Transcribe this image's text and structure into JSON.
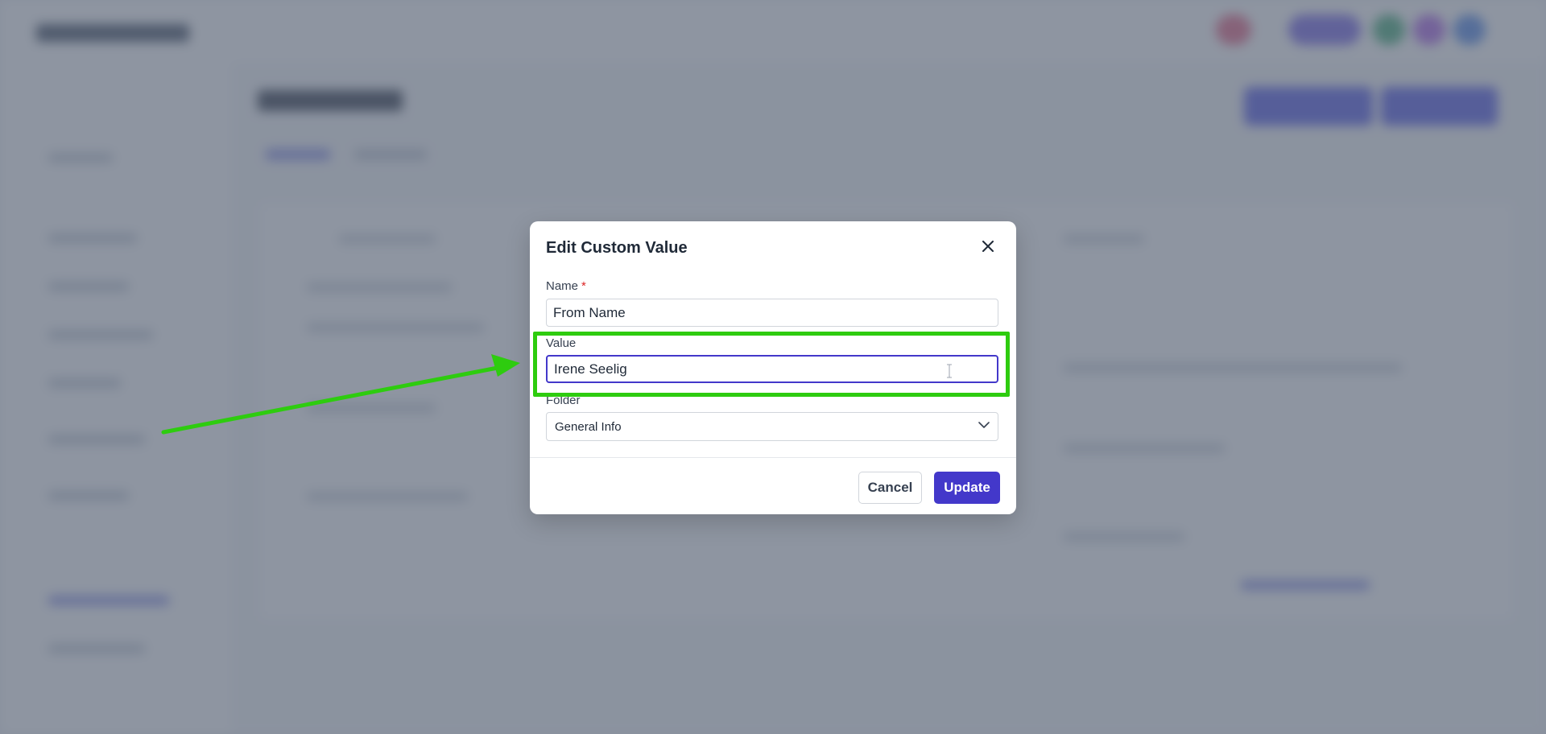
{
  "modal": {
    "title": "Edit Custom Value",
    "close_icon": "close-icon",
    "fields": {
      "name": {
        "label": "Name",
        "required_marker": "*",
        "value": "From Name"
      },
      "value": {
        "label": "Value",
        "value": "Irene Seelig"
      },
      "folder": {
        "label": "Folder",
        "selected": "General Info",
        "icon": "chevron-down-icon"
      }
    },
    "buttons": {
      "cancel": "Cancel",
      "update": "Update"
    }
  },
  "annotation": {
    "highlight_color": "#2ecc0f",
    "arrow_color": "#2ecc0f"
  },
  "colors": {
    "primary": "#4338ca",
    "required": "#dc2626",
    "overlay": "rgba(84, 94, 112, 0.66)"
  }
}
